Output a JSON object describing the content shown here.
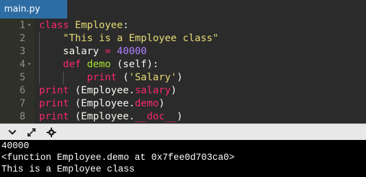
{
  "tab": {
    "title": "main.py"
  },
  "editor": {
    "lines": [
      {
        "num": "1",
        "fold": "▾"
      },
      {
        "num": "2"
      },
      {
        "num": "3"
      },
      {
        "num": "4",
        "fold": "▾"
      },
      {
        "num": "5"
      },
      {
        "num": "6"
      },
      {
        "num": "7"
      },
      {
        "num": "8"
      }
    ],
    "tokens": {
      "l1_kw": "class",
      "l1_name": "Employee",
      "l1_colon": ":",
      "l2_str": "\"This is a Employee class\"",
      "l3_var": "salary",
      "l3_eq": " = ",
      "l3_num": "40000",
      "l4_kw": "def",
      "l4_name": "demo",
      "l4_rest": " (self):",
      "l5_kw": "print",
      "l5_rest_open": " (",
      "l5_str": "'Salary'",
      "l5_close": ")",
      "l6_kw": "print",
      "l6_a": " (Employee.",
      "l6_attr": "salary",
      "l6_b": ")",
      "l7_kw": "print",
      "l7_a": " (Employee.",
      "l7_attr": "demo",
      "l7_b": ")",
      "l8_kw": "print",
      "l8_a": " (Employee.",
      "l8_attr": "__doc__",
      "l8_b": ")"
    }
  },
  "toolbar": {
    "collapse_icon": "chevron-down-icon",
    "expand_icon": "expand-icon",
    "settings_icon": "settings-icon"
  },
  "console": {
    "lines": [
      "40000",
      "<function Employee.demo at 0x7fee0d703ca0>",
      "This is a Employee class"
    ]
  }
}
